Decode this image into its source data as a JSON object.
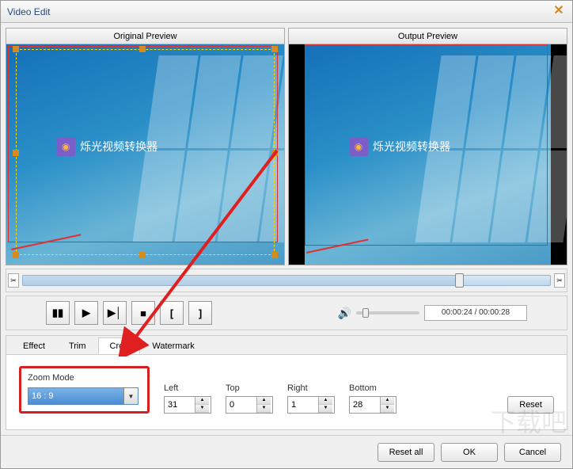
{
  "window": {
    "title": "Video Edit"
  },
  "previews": {
    "original_label": "Original Preview",
    "output_label": "Output Preview",
    "overlay_text": "烁光视频转换器"
  },
  "controls": {
    "time_display": "00:00:24 / 00:00:28"
  },
  "tabs": {
    "effect": "Effect",
    "trim": "Trim",
    "crop": "Crop",
    "watermark": "Watermark"
  },
  "crop": {
    "zoom_mode_label": "Zoom Mode",
    "zoom_mode_value": "16 : 9",
    "left_label": "Left",
    "left_value": "31",
    "top_label": "Top",
    "top_value": "0",
    "right_label": "Right",
    "right_value": "1",
    "bottom_label": "Bottom",
    "bottom_value": "28",
    "reset_label": "Reset"
  },
  "buttons": {
    "reset_all": "Reset all",
    "ok": "OK",
    "cancel": "Cancel"
  },
  "watermark_text": "下载吧"
}
